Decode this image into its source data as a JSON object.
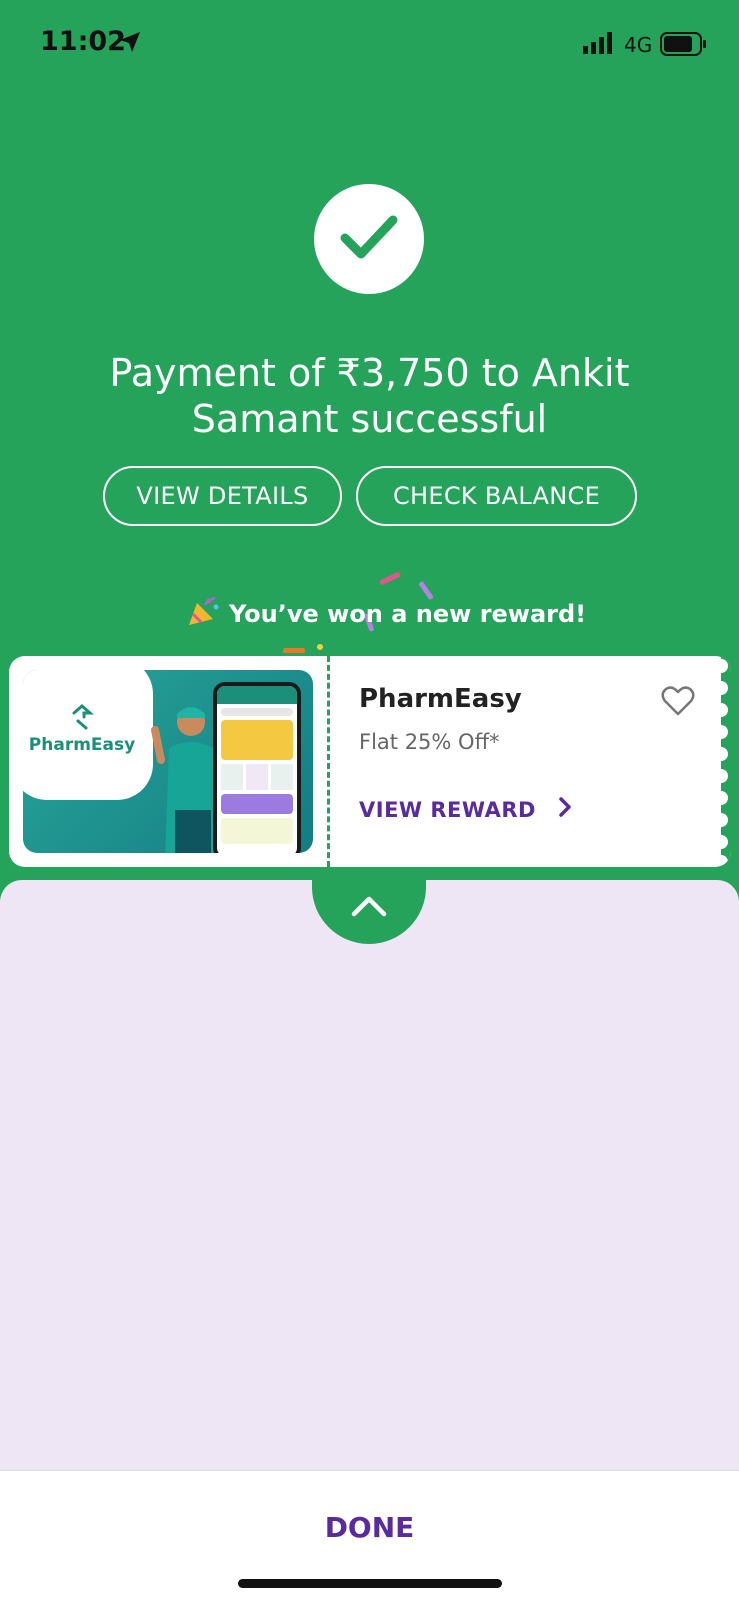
{
  "status_bar": {
    "time": "11:02",
    "network": "4G",
    "icons": [
      "location-arrow-icon",
      "signal-icon",
      "battery-icon"
    ]
  },
  "payment": {
    "title": "Payment of ₹3,750 to Ankit Samant successful",
    "status_icon": "checkmark-icon",
    "view_details_label": "VIEW DETAILS",
    "check_balance_label": "CHECK BALANCE"
  },
  "reward": {
    "headline": "You’ve won a new reward!",
    "headline_icon": "party-popper-icon",
    "brand": "PharmEasy",
    "offer": "Flat 25% Off*",
    "view_reward_label": "VIEW REWARD",
    "logo_text": "PharmEasy"
  },
  "footer": {
    "done_label": "DONE"
  },
  "colors": {
    "green": "#26a35a",
    "purple": "#5a2b9e",
    "sheet": "#eee6f5"
  }
}
